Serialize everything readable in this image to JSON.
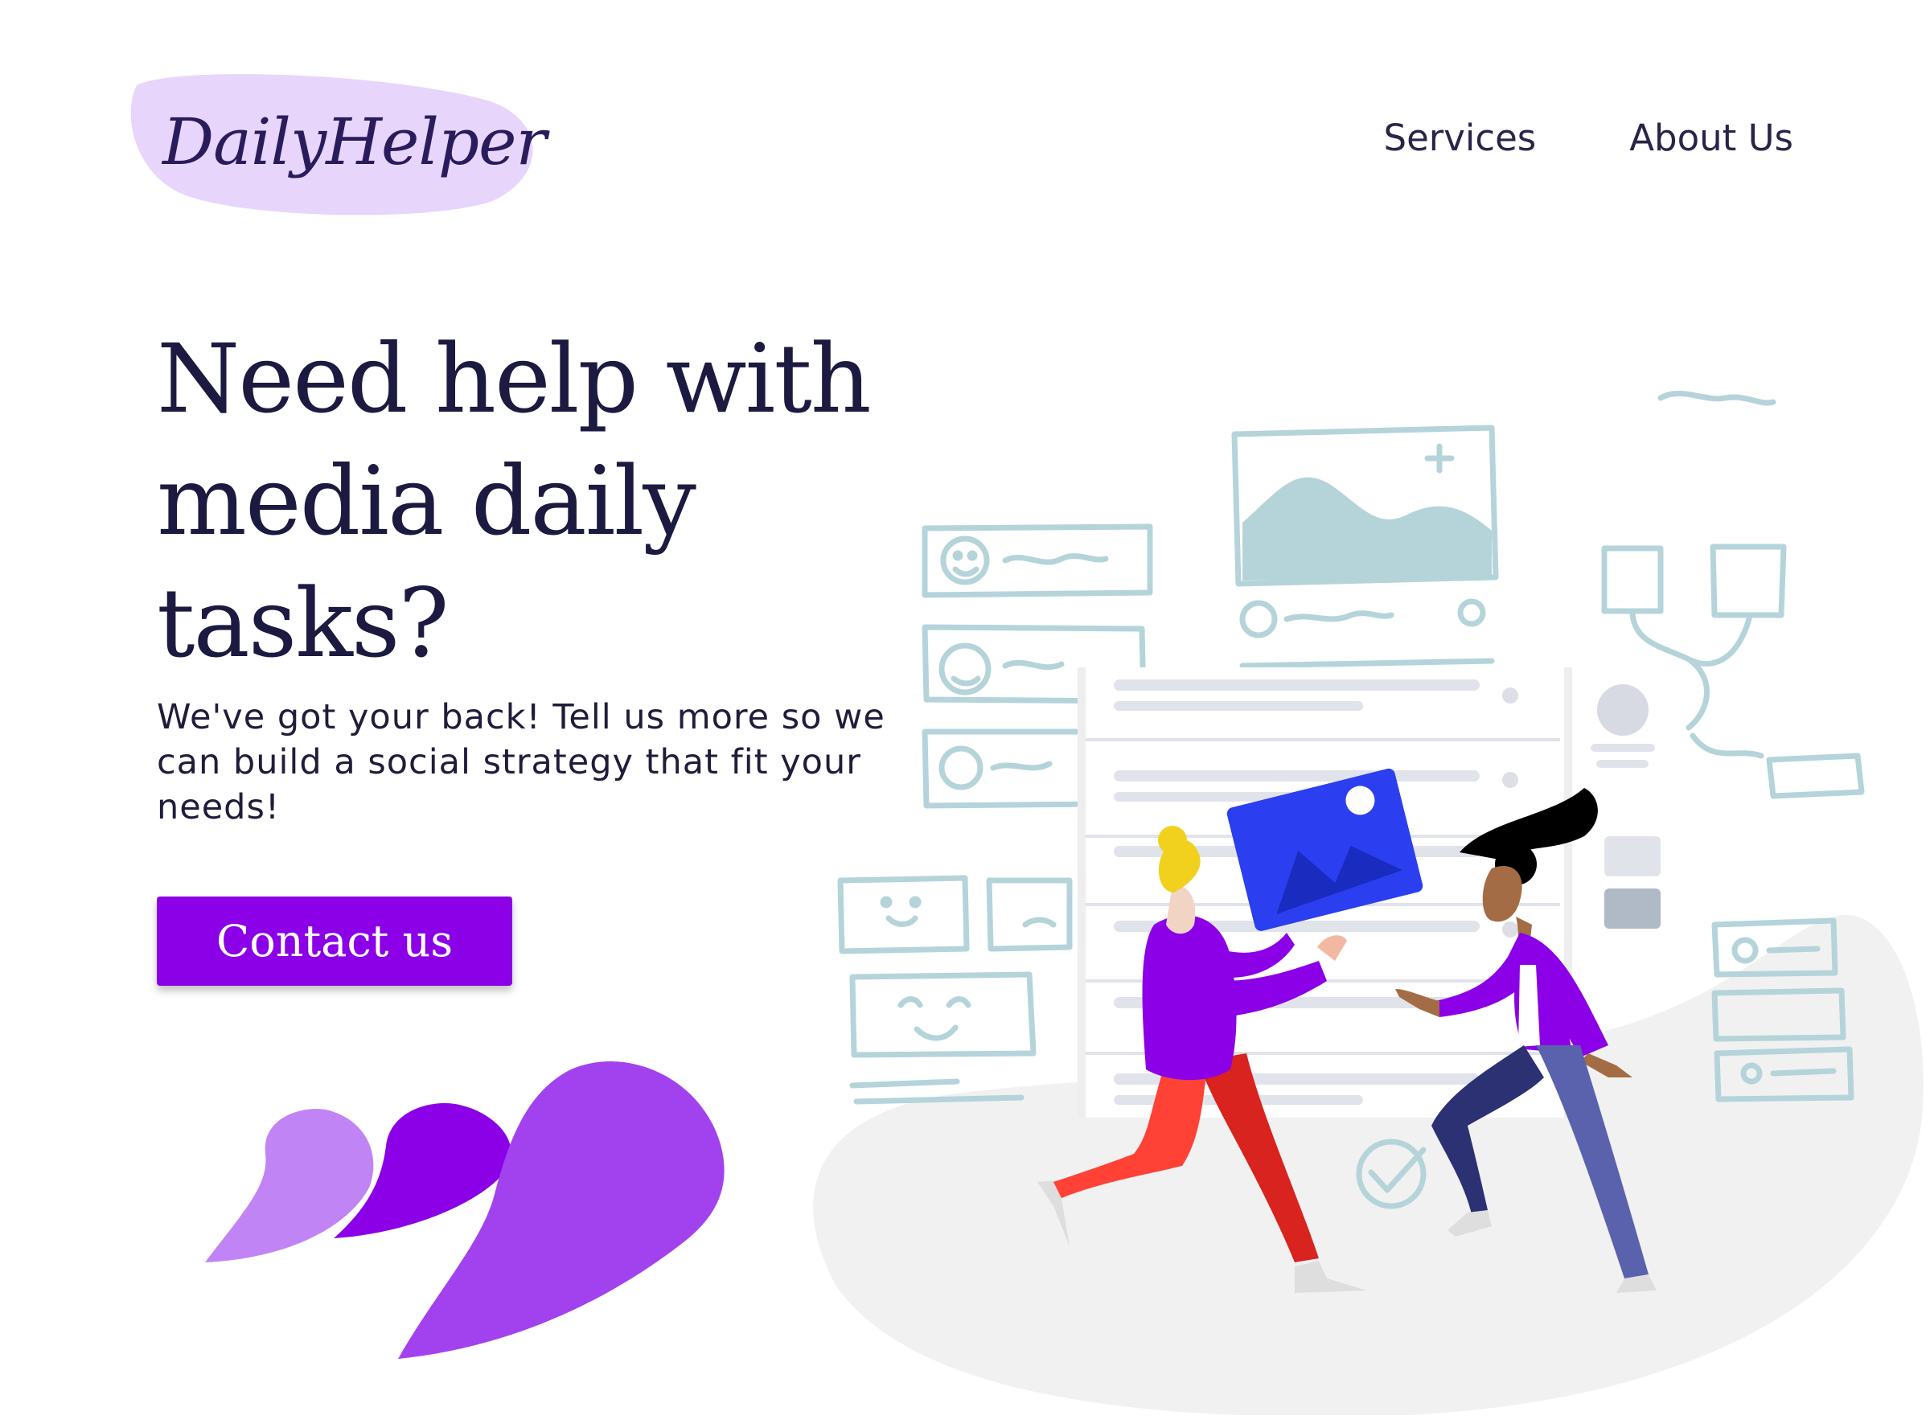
{
  "brand": {
    "name": "DailyHelper"
  },
  "nav": {
    "services": "Services",
    "about": "About Us"
  },
  "hero": {
    "title": "Need help with media daily tasks?",
    "subtitle": "We've got your back! Tell us more so we can build a social strategy that fit your needs!",
    "cta_label": "Contact us"
  },
  "colors": {
    "accent": "#8b00e6",
    "logo_blob": "#e8d5fb",
    "text_dark": "#1c1a40",
    "sketch": "#b5d4da",
    "photo_card": "#2b3ff0"
  },
  "icons": [
    "smiley-face-icon",
    "image-placeholder-icon",
    "checkmark-icon",
    "avatar-icon"
  ]
}
